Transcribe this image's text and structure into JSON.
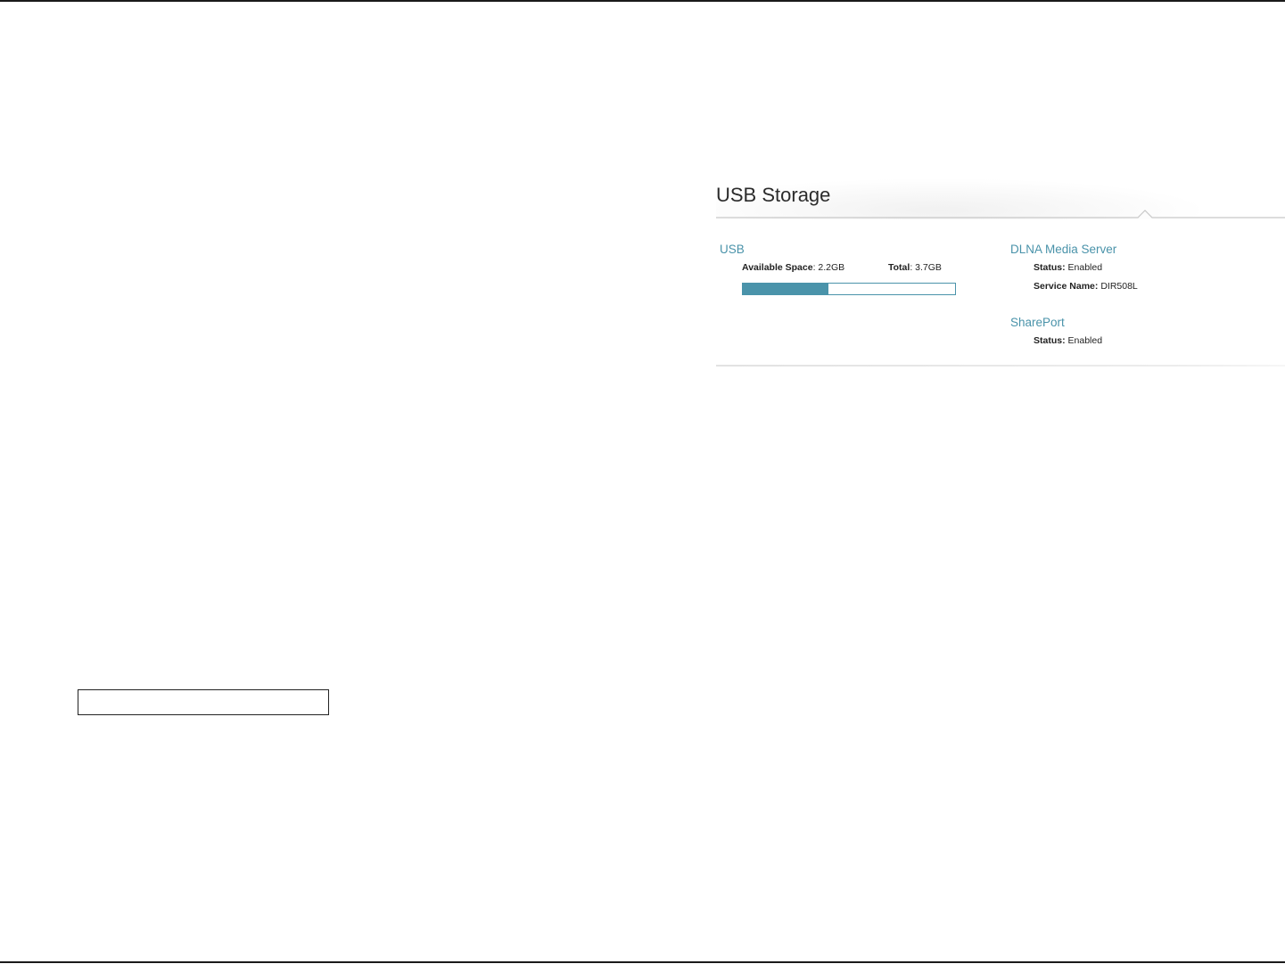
{
  "panel": {
    "title": "USB Storage"
  },
  "usb": {
    "title": "USB",
    "available_label": "Available Space",
    "available_value": "2.2GB",
    "total_label": "Total",
    "total_value": "3.7GB",
    "used_fraction": 0.405,
    "bar_color": "#4a93aa"
  },
  "dlna": {
    "title": "DLNA Media Server",
    "status_label": "Status:",
    "status_value": "Enabled",
    "service_label": "Service Name:",
    "service_value": "DIR508L"
  },
  "shareport": {
    "title": "SharePort",
    "status_label": "Status:",
    "status_value": "Enabled"
  },
  "colors": {
    "accent": "#4a93aa",
    "rule": "#1a1a1a"
  }
}
